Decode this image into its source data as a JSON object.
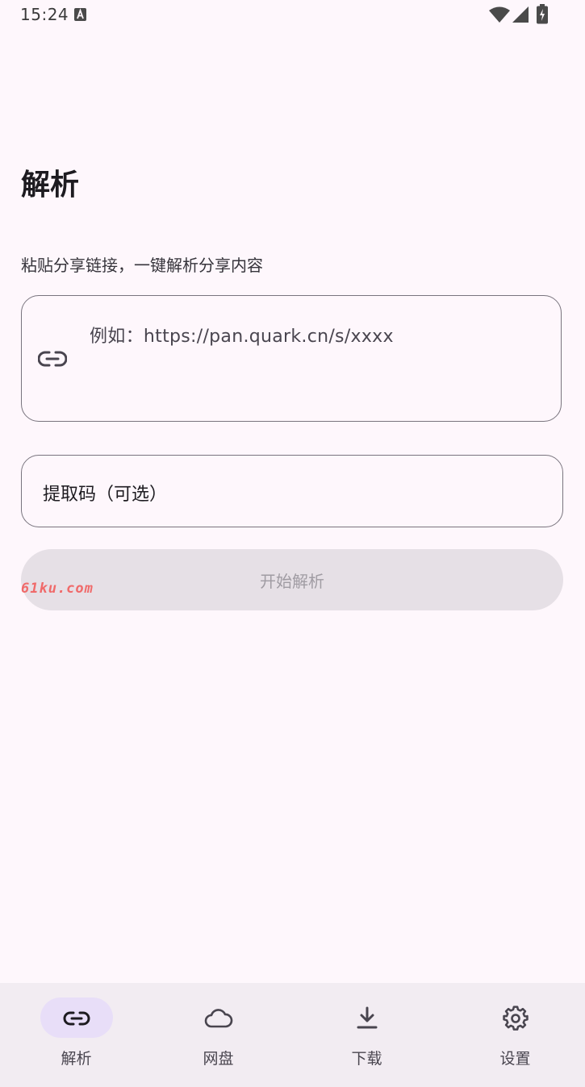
{
  "status_bar": {
    "time": "15:24"
  },
  "page": {
    "title": "解析",
    "subtitle": "粘贴分享链接，一键解析分享内容"
  },
  "link_input": {
    "placeholder": "例如：https://pan.quark.cn/s/xxxx",
    "icon": "link-icon"
  },
  "code_input": {
    "placeholder": "提取码（可选）"
  },
  "start_button": {
    "label": "开始解析",
    "enabled": false
  },
  "watermark": "61ku.com",
  "bottom_nav": {
    "items": [
      {
        "label": "解析",
        "icon": "link-icon",
        "active": true
      },
      {
        "label": "网盘",
        "icon": "cloud-icon",
        "active": false
      },
      {
        "label": "下载",
        "icon": "download-icon",
        "active": false
      },
      {
        "label": "设置",
        "icon": "gear-icon",
        "active": false
      }
    ]
  },
  "colors": {
    "background": "#FEF7FC",
    "nav_background": "#F2ECF2",
    "nav_active_indicator": "#E8DEF8",
    "outline": "#79747E",
    "disabled_button": "#E6E0E6"
  }
}
